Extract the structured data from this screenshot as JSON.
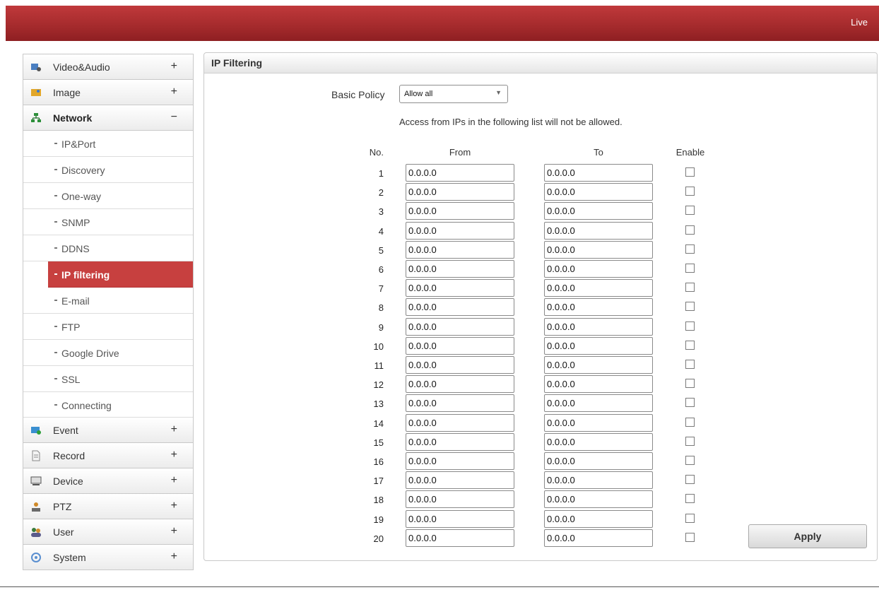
{
  "header": {
    "live_label": "Live"
  },
  "sidebar": {
    "groups_top": [
      {
        "label": "Video&Audio",
        "toggle": "+",
        "icon": "video-audio-icon",
        "color": "#4a7fc1"
      },
      {
        "label": "Image",
        "toggle": "+",
        "icon": "image-icon",
        "color": "#e2a72a"
      }
    ],
    "network": {
      "label": "Network",
      "toggle": "−",
      "icon": "network-icon",
      "color": "#2d8f3a",
      "items": [
        {
          "label": "IP&Port"
        },
        {
          "label": "Discovery"
        },
        {
          "label": "One-way"
        },
        {
          "label": "SNMP"
        },
        {
          "label": "DDNS"
        },
        {
          "label": "IP filtering",
          "active": true
        },
        {
          "label": "E-mail"
        },
        {
          "label": "FTP"
        },
        {
          "label": "Google Drive"
        },
        {
          "label": "SSL"
        },
        {
          "label": "Connecting"
        }
      ]
    },
    "groups_bottom": [
      {
        "label": "Event",
        "toggle": "+",
        "icon": "event-icon",
        "color": "#3a8fd0"
      },
      {
        "label": "Record",
        "toggle": "+",
        "icon": "record-icon",
        "color": "#888888"
      },
      {
        "label": "Device",
        "toggle": "+",
        "icon": "device-icon",
        "color": "#555555"
      },
      {
        "label": "PTZ",
        "toggle": "+",
        "icon": "ptz-icon",
        "color": "#d08a2a"
      },
      {
        "label": "User",
        "toggle": "+",
        "icon": "user-icon",
        "color": "#3a7a3a"
      },
      {
        "label": "System",
        "toggle": "+",
        "icon": "system-icon",
        "color": "#5a8fd0"
      }
    ]
  },
  "main": {
    "title": "IP Filtering",
    "basic_policy_label": "Basic Policy",
    "basic_policy_value": "Allow all",
    "notice": "Access from IPs in the following list will not be allowed.",
    "columns": {
      "no": "No.",
      "from": "From",
      "to": "To",
      "enable": "Enable"
    },
    "rows": [
      {
        "no": "1",
        "from": "0.0.0.0",
        "to": "0.0.0.0",
        "enabled": false
      },
      {
        "no": "2",
        "from": "0.0.0.0",
        "to": "0.0.0.0",
        "enabled": false
      },
      {
        "no": "3",
        "from": "0.0.0.0",
        "to": "0.0.0.0",
        "enabled": false
      },
      {
        "no": "4",
        "from": "0.0.0.0",
        "to": "0.0.0.0",
        "enabled": false
      },
      {
        "no": "5",
        "from": "0.0.0.0",
        "to": "0.0.0.0",
        "enabled": false
      },
      {
        "no": "6",
        "from": "0.0.0.0",
        "to": "0.0.0.0",
        "enabled": false
      },
      {
        "no": "7",
        "from": "0.0.0.0",
        "to": "0.0.0.0",
        "enabled": false
      },
      {
        "no": "8",
        "from": "0.0.0.0",
        "to": "0.0.0.0",
        "enabled": false
      },
      {
        "no": "9",
        "from": "0.0.0.0",
        "to": "0.0.0.0",
        "enabled": false
      },
      {
        "no": "10",
        "from": "0.0.0.0",
        "to": "0.0.0.0",
        "enabled": false
      },
      {
        "no": "11",
        "from": "0.0.0.0",
        "to": "0.0.0.0",
        "enabled": false
      },
      {
        "no": "12",
        "from": "0.0.0.0",
        "to": "0.0.0.0",
        "enabled": false
      },
      {
        "no": "13",
        "from": "0.0.0.0",
        "to": "0.0.0.0",
        "enabled": false
      },
      {
        "no": "14",
        "from": "0.0.0.0",
        "to": "0.0.0.0",
        "enabled": false
      },
      {
        "no": "15",
        "from": "0.0.0.0",
        "to": "0.0.0.0",
        "enabled": false
      },
      {
        "no": "16",
        "from": "0.0.0.0",
        "to": "0.0.0.0",
        "enabled": false
      },
      {
        "no": "17",
        "from": "0.0.0.0",
        "to": "0.0.0.0",
        "enabled": false
      },
      {
        "no": "18",
        "from": "0.0.0.0",
        "to": "0.0.0.0",
        "enabled": false
      },
      {
        "no": "19",
        "from": "0.0.0.0",
        "to": "0.0.0.0",
        "enabled": false
      },
      {
        "no": "20",
        "from": "0.0.0.0",
        "to": "0.0.0.0",
        "enabled": false
      }
    ],
    "apply_label": "Apply"
  }
}
